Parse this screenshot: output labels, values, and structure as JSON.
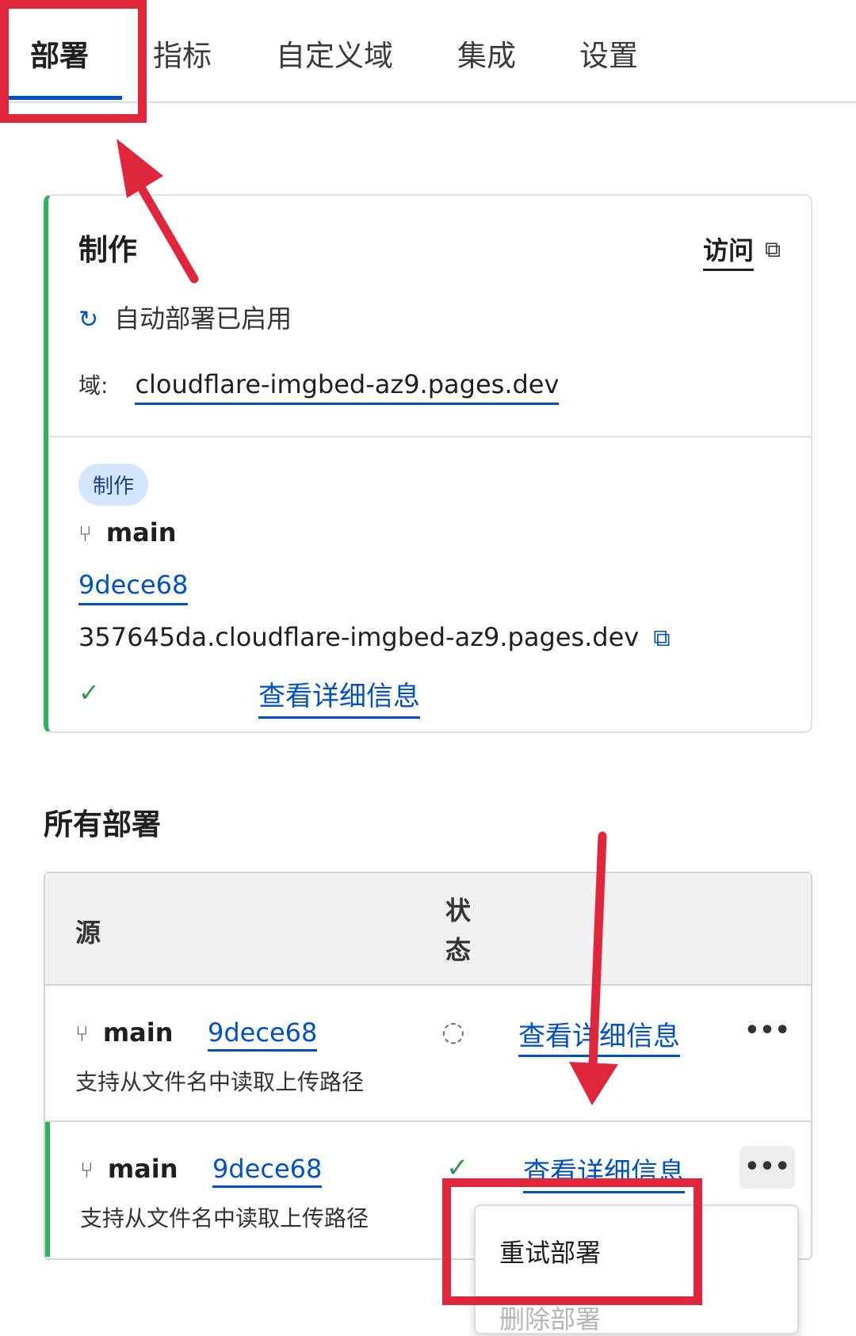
{
  "tabs": [
    {
      "label": "部署",
      "active": true
    },
    {
      "label": "指标"
    },
    {
      "label": "自定义域"
    },
    {
      "label": "集成"
    },
    {
      "label": "设置"
    }
  ],
  "production": {
    "title": "制作",
    "visit_label": "访问",
    "auto_deploy": "自动部署已启用",
    "domain_label": "域:",
    "domain": "cloudflare-imgbed-az9.pages.dev",
    "badge": "制作",
    "branch": "main",
    "commit": "9dece68",
    "deploy_url": "357645da.cloudflare-imgbed-az9.pages.dev",
    "details_label": "查看详细信息"
  },
  "all_deployments": {
    "title": "所有部署",
    "columns": {
      "source": "源",
      "status": "状态"
    },
    "rows": [
      {
        "branch": "main",
        "commit": "9dece68",
        "message": "支持从文件名中读取上传路径",
        "status": "in-progress",
        "details": "查看详细信息",
        "more": "•••"
      },
      {
        "branch": "main",
        "commit": "9dece68",
        "message": "支持从文件名中读取上传路径",
        "status": "success",
        "details": "查看详细信息",
        "more": "•••"
      }
    ]
  },
  "menu": {
    "items": [
      "重试部署",
      "删除部署"
    ]
  },
  "colors": {
    "accent": "#0051c3",
    "success": "#2db35d",
    "annotation": "#e0263b"
  }
}
